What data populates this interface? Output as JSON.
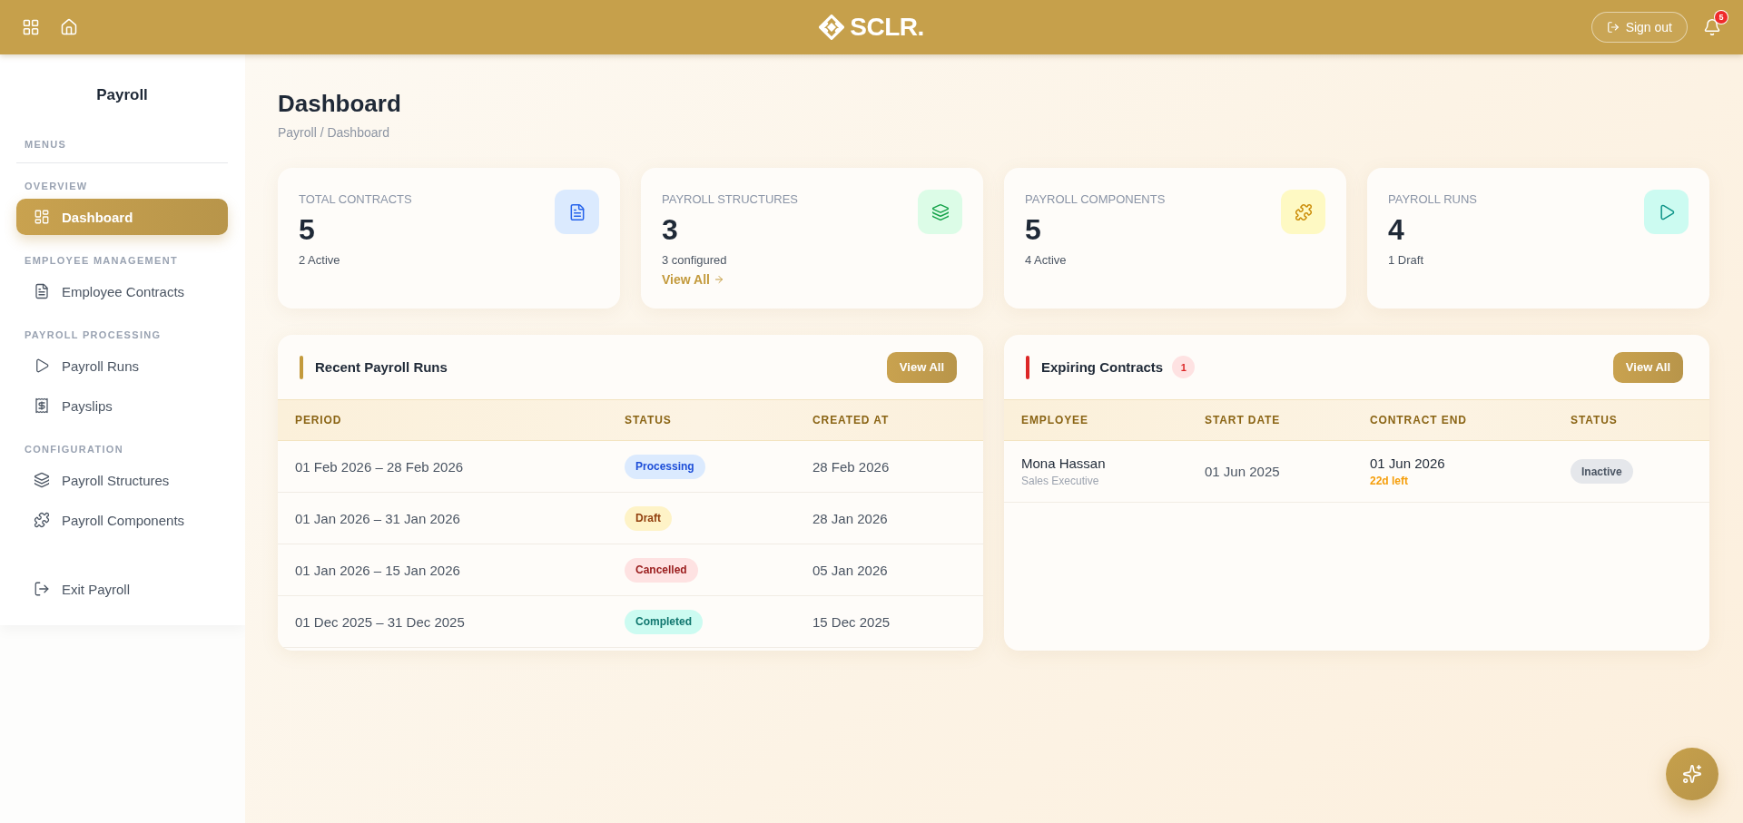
{
  "topbar": {
    "brand": "SCLR.",
    "sign_out": "Sign out",
    "notification_count": "5"
  },
  "sidebar": {
    "title": "Payroll",
    "menus_label": "MENUS",
    "sections": [
      {
        "label": "OVERVIEW",
        "items": [
          {
            "label": "Dashboard",
            "kind": "dashboard",
            "selected": true
          }
        ]
      },
      {
        "label": "EMPLOYEE MANAGEMENT",
        "items": [
          {
            "label": "Employee Contracts",
            "kind": "contracts",
            "selected": false
          }
        ]
      },
      {
        "label": "PAYROLL PROCESSING",
        "items": [
          {
            "label": "Payroll Runs",
            "kind": "runs",
            "selected": false
          },
          {
            "label": "Payslips",
            "kind": "payslips",
            "selected": false
          }
        ]
      },
      {
        "label": "CONFIGURATION",
        "items": [
          {
            "label": "Payroll Structures",
            "kind": "structures",
            "selected": false
          },
          {
            "label": "Payroll Components",
            "kind": "components",
            "selected": false
          }
        ]
      }
    ],
    "exit": {
      "label": "Exit Payroll"
    }
  },
  "page": {
    "title": "Dashboard",
    "breadcrumb": "Payroll / Dashboard"
  },
  "stats": [
    {
      "kind": "contracts",
      "label": "TOTAL CONTRACTS",
      "value": "5",
      "caption": "2 Active"
    },
    {
      "kind": "structures",
      "label": "PAYROLL STRUCTURES",
      "value": "3",
      "caption": "3 configured",
      "link": "View All"
    },
    {
      "kind": "components",
      "label": "PAYROLL COMPONENTS",
      "value": "5",
      "caption": "4 Active"
    },
    {
      "kind": "runs",
      "label": "PAYROLL RUNS",
      "value": "4",
      "caption": "1 Draft"
    }
  ],
  "recent_runs": {
    "title": "Recent Payroll Runs",
    "button": "View All",
    "columns": [
      "PERIOD",
      "STATUS",
      "CREATED AT"
    ],
    "rows": [
      {
        "period": "01 Feb 2026 – 28 Feb 2026",
        "status": {
          "label": "Processing",
          "kind": "processing"
        },
        "created_at": "28 Feb 2026"
      },
      {
        "period": "01 Jan 2026 – 31 Jan 2026",
        "status": {
          "label": "Draft",
          "kind": "draft"
        },
        "created_at": "28 Jan 2026"
      },
      {
        "period": "01 Jan 2026 – 15 Jan 2026",
        "status": {
          "label": "Cancelled",
          "kind": "cancelled"
        },
        "created_at": "05 Jan 2026"
      },
      {
        "period": "01 Dec 2025 – 31 Dec 2025",
        "status": {
          "label": "Completed",
          "kind": "completed"
        },
        "created_at": "15 Dec 2025"
      }
    ]
  },
  "expiring_contracts": {
    "title": "Expiring Contracts",
    "count": "1",
    "button": "View All",
    "columns": [
      "EMPLOYEE",
      "START DATE",
      "CONTRACT END",
      "STATUS"
    ],
    "rows": [
      {
        "employee": "Mona Hassan",
        "role": "Sales Executive",
        "start_date": "01 Jun 2025",
        "contract_end": "01 Jun 2026",
        "remaining": "22d left",
        "status": {
          "label": "Inactive",
          "kind": "inactive"
        }
      }
    ]
  }
}
